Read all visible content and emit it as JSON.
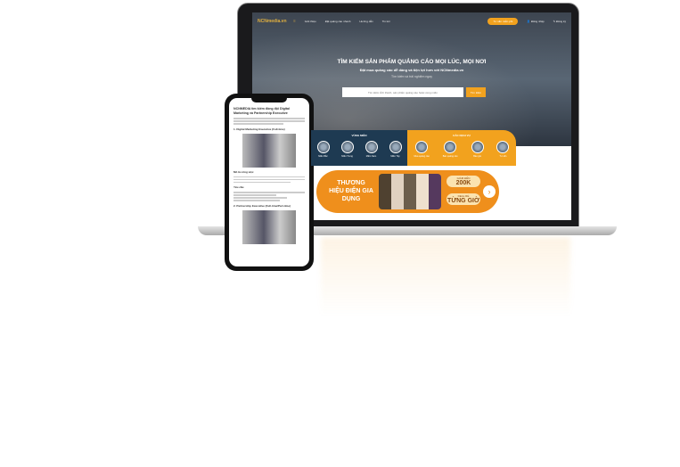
{
  "laptop": {
    "nav": {
      "logo": "NCNmedia.vn",
      "links": [
        "Giới thiệu",
        "Đặt quảng cáo nhanh",
        "Hướng dẫn",
        "Tin tức"
      ],
      "cta": "Tư vấn miễn phí",
      "login": "Đăng nhập",
      "register": "Đăng ký"
    },
    "hero": {
      "title": "TÌM KIẾM SẢN PHẨM QUẢNG CÁO MỌI LÚC, MỌI NƠI",
      "subtitle": "Đặt mua quảng cáo dễ dàng và tiện lợi hơn với NCNmedia.vn",
      "subtitle2": "Tìm kiếm và trải nghiệm ngay",
      "search_placeholder": "Tìm kiếm tỉnh thành, sản phẩm quảng cáo hoặc vùng miền",
      "search_button": "Tìm kiếm"
    },
    "regions": {
      "title": "VÙNG MIỀN",
      "items": [
        "Miền Bắc",
        "Miền Trung",
        "Miền Nam",
        "Miền Tây"
      ]
    },
    "services": {
      "title": "CÁC DỊCH VỤ",
      "items": [
        "Mua quảng cáo",
        "Bán quảng cáo",
        "Báo giá",
        "Tư vấn"
      ]
    },
    "banner": {
      "title": "THƯƠNG HIỆU ĐIỆN GIA DỤNG",
      "pill1_top": "GIẢM ĐẾN",
      "pill1_value": "200K",
      "pill2_top": "DEAL RẺ",
      "pill2_value": "TỪNG GIỜ"
    }
  },
  "phone": {
    "title": "NCNMEDIA tìm kiếm đồng đội Digital Marketing và Partnership Executive",
    "section1": "1. Digital Marketing Executive (Full-time)",
    "job_desc": "Mô tả công việc",
    "requirements": "Yêu cầu",
    "section2": "2. Partnership Executive (Full-time/Part-time)"
  },
  "colors": {
    "accent": "#f2a21e",
    "navy": "#1e3a52"
  }
}
